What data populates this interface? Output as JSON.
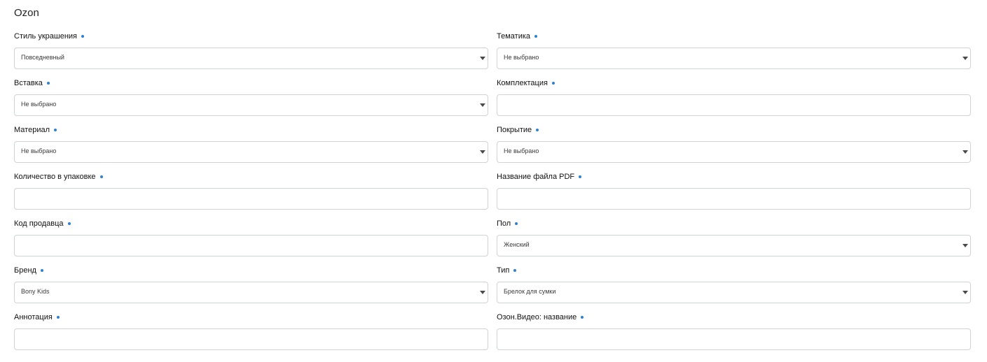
{
  "section": {
    "title": "Ozon"
  },
  "fields": [
    {
      "label": "Стиль украшения",
      "type": "select",
      "value": "Повседневный"
    },
    {
      "label": "Тематика",
      "type": "select",
      "value": "Не выбрано"
    },
    {
      "label": "Вставка",
      "type": "select",
      "value": "Не выбрано"
    },
    {
      "label": "Комплектация",
      "type": "input",
      "value": ""
    },
    {
      "label": "Материал",
      "type": "select",
      "value": "Не выбрано"
    },
    {
      "label": "Покрытие",
      "type": "select",
      "value": "Не выбрано"
    },
    {
      "label": "Количество в упаковке",
      "type": "input",
      "value": ""
    },
    {
      "label": "Название файла PDF",
      "type": "input",
      "value": ""
    },
    {
      "label": "Код продавца",
      "type": "input",
      "value": ""
    },
    {
      "label": "Пол",
      "type": "select",
      "value": "Женский"
    },
    {
      "label": "Бренд",
      "type": "select",
      "value": "Bony Kids"
    },
    {
      "label": "Тип",
      "type": "select",
      "value": "Брелок для сумки"
    },
    {
      "label": "Аннотация",
      "type": "input",
      "value": ""
    },
    {
      "label": "Озон.Видео: название",
      "type": "input",
      "value": ""
    }
  ],
  "colors": {
    "required_dot": "#2f7fd3",
    "border": "#cfd3d8"
  }
}
